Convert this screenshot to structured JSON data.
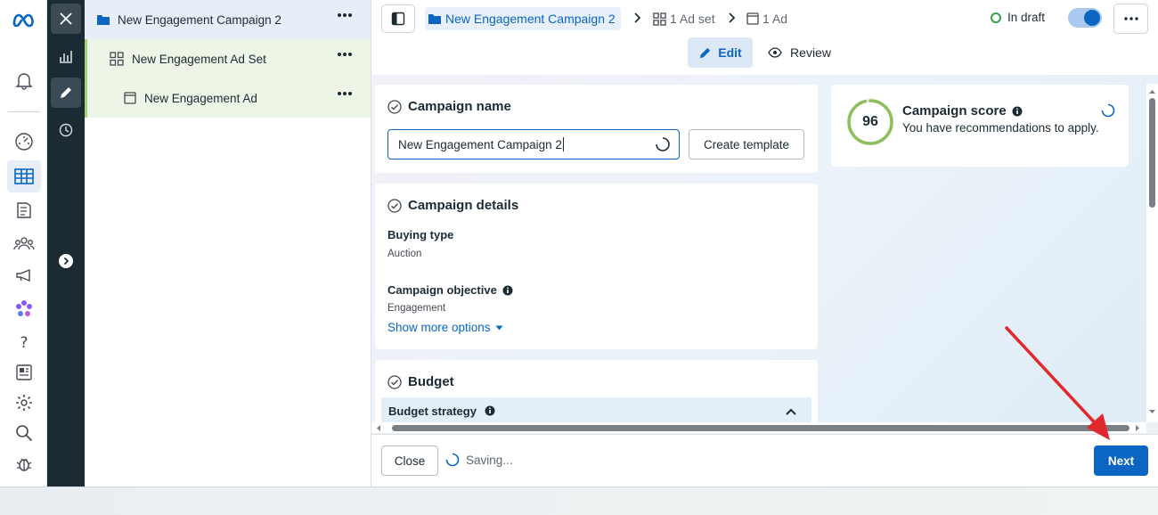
{
  "tree": {
    "campaign": "New Engagement Campaign 2",
    "ad_set": "New Engagement Ad Set",
    "ad": "New Engagement Ad"
  },
  "breadcrumb": {
    "campaign": "New Engagement Campaign 2",
    "ad_set": "1 Ad set",
    "ad": "1 Ad"
  },
  "status": {
    "label": "In draft"
  },
  "tabs": {
    "edit": "Edit",
    "review": "Review"
  },
  "campaign_name": {
    "title": "Campaign name",
    "value": "New Engagement Campaign 2",
    "create_template": "Create template"
  },
  "campaign_details": {
    "title": "Campaign details",
    "buying_type_label": "Buying type",
    "buying_type_value": "Auction",
    "objective_label": "Campaign objective",
    "objective_value": "Engagement",
    "show_more": "Show more options"
  },
  "budget": {
    "title": "Budget",
    "strategy_label": "Budget strategy"
  },
  "score": {
    "value": "96",
    "value_fraction": 0.96,
    "title": "Campaign score",
    "subtitle": "You have recommendations to apply."
  },
  "footer": {
    "close": "Close",
    "saving": "Saving...",
    "next": "Next"
  },
  "colors": {
    "accent": "#0a66c2",
    "score_ring": "#8fbf5a",
    "annotation_arrow": "#e0282e"
  }
}
